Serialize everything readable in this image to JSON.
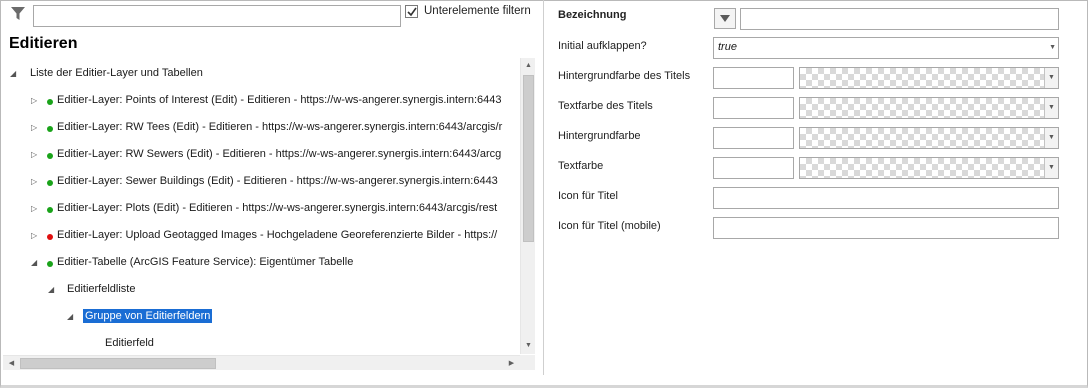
{
  "filter": {
    "icon": "filter-icon",
    "input_value": "",
    "sub_elements_label": "Unterelemente filtern",
    "sub_elements_checked": true
  },
  "section": {
    "title": "Editieren"
  },
  "tree": {
    "items": [
      {
        "label": "Liste der Editier-Layer und Tabellen",
        "expanded": true,
        "status": ""
      },
      {
        "label": "Editier-Layer: Points of Interest (Edit) - Editieren - https://w-ws-angerer.synergis.intern:6443",
        "expanded": false,
        "status": "green"
      },
      {
        "label": "Editier-Layer: RW Tees (Edit) - Editieren - https://w-ws-angerer.synergis.intern:6443/arcgis/r",
        "expanded": false,
        "status": "green"
      },
      {
        "label": "Editier-Layer: RW Sewers (Edit) - Editieren - https://w-ws-angerer.synergis.intern:6443/arcg",
        "expanded": false,
        "status": "green"
      },
      {
        "label": "Editier-Layer: Sewer Buildings (Edit) - Editieren - https://w-ws-angerer.synergis.intern:6443",
        "expanded": false,
        "status": "green"
      },
      {
        "label": "Editier-Layer: Plots (Edit) - Editieren - https://w-ws-angerer.synergis.intern:6443/arcgis/rest",
        "expanded": false,
        "status": "green"
      },
      {
        "label": "Editier-Layer: Upload Geotagged Images - Hochgeladene Georeferenzierte Bilder - https://",
        "expanded": false,
        "status": "red"
      },
      {
        "label": "Editier-Tabelle (ArcGIS Feature Service): Eigentümer Tabelle",
        "expanded": true,
        "status": "green"
      },
      {
        "label": "Editierfeldliste",
        "expanded": true,
        "status": ""
      },
      {
        "label": "Gruppe von Editierfeldern",
        "expanded": true,
        "status": "",
        "selected": true
      },
      {
        "label": "Editierfeld",
        "expanded": false,
        "status": ""
      }
    ]
  },
  "properties": {
    "name_label": "Bezeichnung",
    "name_value": "",
    "expand_label": "Initial aufklappen?",
    "expand_value": "true",
    "title_bg_label": "Hintergrundfarbe des Titels",
    "title_bg_value": "",
    "title_text_label": "Textfarbe des Titels",
    "title_text_value": "",
    "bg_label": "Hintergrundfarbe",
    "bg_value": "",
    "text_label": "Textfarbe",
    "text_value": "",
    "icon_label": "Icon für Titel",
    "icon_value": "",
    "icon_mobile_label": "Icon für Titel (mobile)",
    "icon_mobile_value": ""
  },
  "colors": {
    "selection": "#1a6dd4",
    "status_green": "#1aa31a",
    "status_red": "#e00f0f"
  }
}
